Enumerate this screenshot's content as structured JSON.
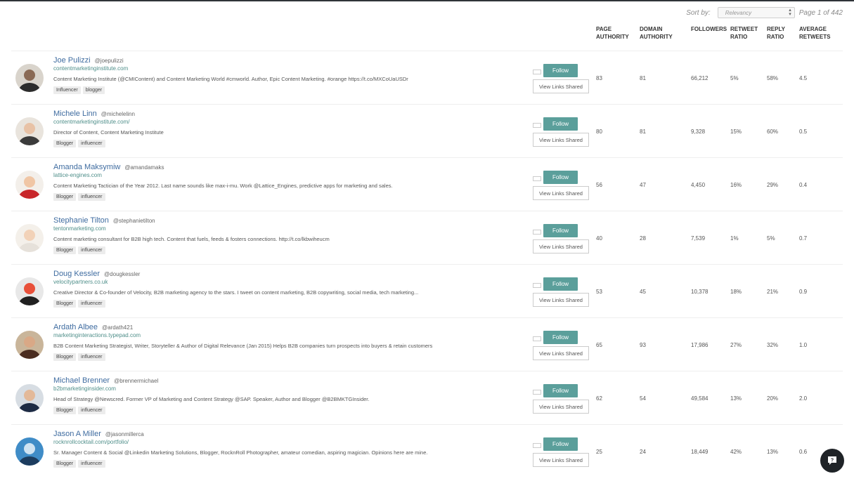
{
  "sort": {
    "label": "Sort by:",
    "value": "Relevancy",
    "page_info": "Page 1 of 442"
  },
  "columns": {
    "page_authority": "PAGE AUTHORITY",
    "domain_authority": "DOMAIN AUTHORITY",
    "followers": "FOLLOWERS",
    "retweet_ratio": "RETWEET RATIO",
    "reply_ratio": "REPLY RATIO",
    "average_retweets": "AVERAGE RETWEETS"
  },
  "buttons": {
    "follow": "Follow",
    "view_links": "View Links Shared"
  },
  "people": [
    {
      "name": "Joe Pulizzi",
      "handle": "@joepulizzi",
      "site": "contentmarketinginstitute.com",
      "bio": "Content Marketing Institute (@CMIContent) and Content Marketing World #cmworld. Author, Epic Content Marketing. #orange https://t.co/MXCoUaUSDr",
      "tags": [
        "Influencer",
        "blogger"
      ],
      "page_authority": "83",
      "domain_authority": "81",
      "followers": "66,212",
      "retweet_ratio": "5%",
      "reply_ratio": "58%",
      "average_retweets": "4.5"
    },
    {
      "name": "Michele Linn",
      "handle": "@michelelinn",
      "site": "contentmarketinginstitute.com/",
      "bio": "Director of Content, Content Marketing Institute",
      "tags": [
        "Blogger",
        "influencer"
      ],
      "page_authority": "80",
      "domain_authority": "81",
      "followers": "9,328",
      "retweet_ratio": "15%",
      "reply_ratio": "60%",
      "average_retweets": "0.5"
    },
    {
      "name": "Amanda Maksymiw",
      "handle": "@amandamaks",
      "site": "lattice-engines.com",
      "bio": "Content Marketing Tactician of the Year 2012. Last name sounds like max-i-mu. Work @Lattice_Engines, predictive apps for marketing and sales.",
      "tags": [
        "Blogger",
        "influencer"
      ],
      "page_authority": "56",
      "domain_authority": "47",
      "followers": "4,450",
      "retweet_ratio": "16%",
      "reply_ratio": "29%",
      "average_retweets": "0.4"
    },
    {
      "name": "Stephanie Tilton",
      "handle": "@stephanietilton",
      "site": "tentonmarketing.com",
      "bio": "Content marketing consultant for B2B high tech. Content that fuels, feeds & fosters connections. http://t.co/lkbwiheucm",
      "tags": [
        "Blogger",
        "influencer"
      ],
      "page_authority": "40",
      "domain_authority": "28",
      "followers": "7,539",
      "retweet_ratio": "1%",
      "reply_ratio": "5%",
      "average_retweets": "0.7"
    },
    {
      "name": "Doug Kessler",
      "handle": "@dougkessler",
      "site": "velocitypartners.co.uk",
      "bio": "Creative Director & Co-founder of Velocity, B2B marketing agency to the stars. I tweet on content marketing, B2B copywriting, social media, tech marketing...",
      "tags": [
        "Blogger",
        "influencer"
      ],
      "page_authority": "53",
      "domain_authority": "45",
      "followers": "10,378",
      "retweet_ratio": "18%",
      "reply_ratio": "21%",
      "average_retweets": "0.9"
    },
    {
      "name": "Ardath Albee",
      "handle": "@ardath421",
      "site": "marketinginteractions.typepad.com",
      "bio": "B2B Content Marketing Strategist, Writer, Storyteller & Author of Digital Relevance (Jan 2015) Helps B2B companies turn prospects into buyers & retain customers",
      "tags": [
        "Blogger",
        "influencer"
      ],
      "page_authority": "65",
      "domain_authority": "93",
      "followers": "17,986",
      "retweet_ratio": "27%",
      "reply_ratio": "32%",
      "average_retweets": "1.0"
    },
    {
      "name": "Michael Brenner",
      "handle": "@brennermichael",
      "site": "b2bmarketinginsider.com",
      "bio": "Head of Strategy @Newscred. Former VP of Marketing and Content Strategy @SAP. Speaker, Author and Blogger @B2BMKTGInsider.",
      "tags": [
        "Blogger",
        "influencer"
      ],
      "page_authority": "62",
      "domain_authority": "54",
      "followers": "49,584",
      "retweet_ratio": "13%",
      "reply_ratio": "20%",
      "average_retweets": "2.0"
    },
    {
      "name": "Jason A Miller",
      "handle": "@jasonmillerca",
      "site": "rocknrollcocktail.com/portfolio/",
      "bio": "Sr. Manager Content & Social @Linkedin Marketing Solutions, Blogger, RocknRoll Photographer, amateur comedian, aspiring magician. Opinions here are mine.",
      "tags": [
        "Blogger",
        "influencer"
      ],
      "page_authority": "25",
      "domain_authority": "24",
      "followers": "18,449",
      "retweet_ratio": "42%",
      "reply_ratio": "13%",
      "average_retweets": "0.6"
    }
  ],
  "avatars": [
    {
      "bg": "#d9d4cc",
      "face": "#8a6a55",
      "shirt": "#2c2c2c"
    },
    {
      "bg": "#e9e4dd",
      "face": "#e8c2a6",
      "shirt": "#3b3b3b"
    },
    {
      "bg": "#f3efea",
      "face": "#f0c6a5",
      "shirt": "#c8262a"
    },
    {
      "bg": "#f4f0ea",
      "face": "#f2d2b8",
      "shirt": "#e6e1da"
    },
    {
      "bg": "#e8e8e8",
      "face": "#e8503a",
      "shirt": "#202020"
    },
    {
      "bg": "#c9b59a",
      "face": "#d9a886",
      "shirt": "#4b2d20"
    },
    {
      "bg": "#d7dde3",
      "face": "#e3b999",
      "shirt": "#1d2b44"
    },
    {
      "bg": "#3f8cc7",
      "face": "#cfe3f2",
      "shirt": "#1c3c5e"
    }
  ],
  "icons": {
    "chat": "chat-help-icon",
    "sort_arrows": "sort-arrows-icon"
  }
}
